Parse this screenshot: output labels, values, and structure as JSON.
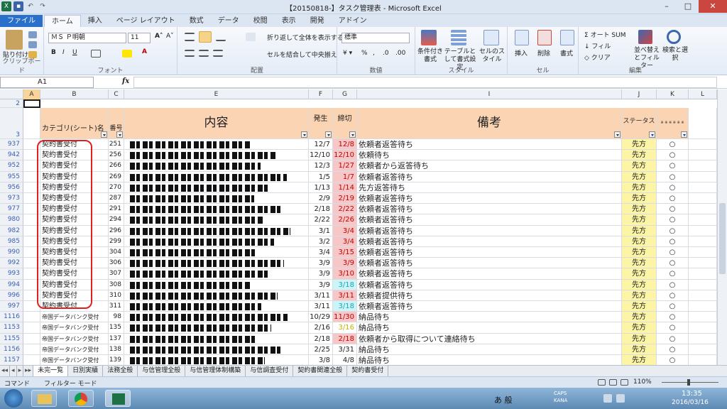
{
  "window": {
    "title": "【20150818-】タスク管理表 - Microsoft Excel"
  },
  "ribbon_tabs": [
    "ファイル",
    "ホーム",
    "挿入",
    "ページ レイアウト",
    "数式",
    "データ",
    "校閲",
    "表示",
    "開発",
    "アドイン"
  ],
  "ribbon": {
    "clipboard": {
      "paste": "貼り付け",
      "group": "クリップボード"
    },
    "font": {
      "name": "ＭＳ Ｐ明朝",
      "size": "11",
      "group": "フォント"
    },
    "alignment": {
      "wrap": "折り返して全体を表示する",
      "merge": "セルを結合して中央揃え",
      "group": "配置"
    },
    "number": {
      "format": "標準",
      "group": "数値"
    },
    "styles": {
      "cond": "条件付き書式",
      "table": "テーブルとして書式設定",
      "cell": "セルのスタイル",
      "group": "スタイル"
    },
    "cells": {
      "insert": "挿入",
      "delete": "削除",
      "format": "書式",
      "group": "セル"
    },
    "editing": {
      "autosum": "オート SUM",
      "fill": "フィル",
      "clear": "クリア",
      "sort": "並べ替えとフィルター",
      "find": "検索と選択",
      "group": "編集"
    }
  },
  "formula_bar": {
    "namebox": "A1",
    "fx": "fx"
  },
  "columns": [
    "A",
    "B",
    "C",
    "E",
    "F",
    "G",
    "I",
    "J",
    "K",
    "L"
  ],
  "header_row": {
    "row_num_2": "2",
    "row_num": "3",
    "category": "カテゴリ(シート)名",
    "no": "番号",
    "content": "内容",
    "issued": "発生",
    "due": "締切",
    "notes": "備考",
    "status": "ステータス",
    "extra": "※ ※ ※ ※ ※ ※"
  },
  "rows": [
    {
      "r": "937",
      "cat": "契約書受付",
      "no": "251",
      "issued": "12/7",
      "due": "12/8",
      "dueFmt": "red",
      "note": "依頼者返答待ち",
      "status": "先方"
    },
    {
      "r": "942",
      "cat": "契約書受付",
      "no": "256",
      "issued": "12/10",
      "due": "12/10",
      "dueFmt": "red",
      "note": "依頼待ち",
      "status": "先方"
    },
    {
      "r": "952",
      "cat": "契約書受付",
      "no": "266",
      "issued": "12/3",
      "due": "1/27",
      "dueFmt": "red",
      "note": "依頼者から返答待ち",
      "status": "先方"
    },
    {
      "r": "955",
      "cat": "契約書受付",
      "no": "269",
      "issued": "1/5",
      "due": "1/7",
      "dueFmt": "red",
      "note": "依頼者返答待ち",
      "status": "先方"
    },
    {
      "r": "956",
      "cat": "契約書受付",
      "no": "270",
      "issued": "1/13",
      "due": "1/14",
      "dueFmt": "red",
      "note": "先方返答待ち",
      "status": "先方"
    },
    {
      "r": "973",
      "cat": "契約書受付",
      "no": "287",
      "issued": "2/9",
      "due": "2/19",
      "dueFmt": "red",
      "note": "依頼者返答待ち",
      "status": "先方"
    },
    {
      "r": "977",
      "cat": "契約書受付",
      "no": "291",
      "issued": "2/18",
      "due": "2/22",
      "dueFmt": "red",
      "note": "依頼者返答待ち",
      "status": "先方"
    },
    {
      "r": "980",
      "cat": "契約書受付",
      "no": "294",
      "issued": "2/22",
      "due": "2/26",
      "dueFmt": "red",
      "note": "依頼者返答待ち",
      "status": "先方"
    },
    {
      "r": "982",
      "cat": "契約書受付",
      "no": "296",
      "issued": "3/1",
      "due": "3/4",
      "dueFmt": "red",
      "note": "依頼者返答待ち",
      "status": "先方"
    },
    {
      "r": "985",
      "cat": "契約書受付",
      "no": "299",
      "issued": "3/2",
      "due": "3/4",
      "dueFmt": "red",
      "note": "依頼者返答待ち",
      "status": "先方"
    },
    {
      "r": "990",
      "cat": "契約書受付",
      "no": "304",
      "issued": "3/4",
      "due": "3/15",
      "dueFmt": "red",
      "note": "依頼者返答待ち",
      "status": "先方"
    },
    {
      "r": "992",
      "cat": "契約書受付",
      "no": "306",
      "issued": "3/9",
      "due": "3/9",
      "dueFmt": "red",
      "note": "依頼者返答待ち",
      "status": "先方"
    },
    {
      "r": "993",
      "cat": "契約書受付",
      "no": "307",
      "issued": "3/9",
      "due": "3/10",
      "dueFmt": "red",
      "note": "依頼者返答待ち",
      "status": "先方"
    },
    {
      "r": "994",
      "cat": "契約書受付",
      "no": "308",
      "issued": "3/9",
      "due": "3/18",
      "dueFmt": "cyan",
      "note": "依頼者返答待ち",
      "status": "先方"
    },
    {
      "r": "996",
      "cat": "契約書受付",
      "no": "310",
      "issued": "3/11",
      "due": "3/11",
      "dueFmt": "red",
      "note": "依頼者提供待ち",
      "status": "先方"
    },
    {
      "r": "997",
      "cat": "契約書受付",
      "no": "311",
      "issued": "3/11",
      "due": "3/18",
      "dueFmt": "cyan",
      "note": "依頼者返答待ち",
      "status": "先方"
    },
    {
      "r": "1116",
      "cat": "帝国データバンク受付",
      "no": "98",
      "issued": "10/29",
      "due": "11/30",
      "dueFmt": "red",
      "note": "納品待ち",
      "status": "先方"
    },
    {
      "r": "1153",
      "cat": "帝国データバンク受付",
      "no": "135",
      "issued": "2/16",
      "due": "3/16",
      "dueFmt": "yellow",
      "note": "納品待ち",
      "status": "先方"
    },
    {
      "r": "1155",
      "cat": "帝国データバンク受付",
      "no": "137",
      "issued": "2/18",
      "due": "2/18",
      "dueFmt": "red",
      "note": "依頼者から取得について連絡待ち",
      "status": "先方"
    },
    {
      "r": "1156",
      "cat": "帝国データバンク受付",
      "no": "138",
      "issued": "2/25",
      "due": "3/31",
      "dueFmt": "none",
      "note": "納品待ち",
      "status": "先方"
    },
    {
      "r": "1157",
      "cat": "帝国データバンク受付",
      "no": "139",
      "issued": "3/8",
      "due": "4/8",
      "dueFmt": "none",
      "note": "納品待ち",
      "status": "先方"
    }
  ],
  "marks": {
    "circle": "○"
  },
  "sheet_tabs": [
    "未完一覧",
    "日別実績",
    "法務全般",
    "与信管理全般",
    "与信管理体制構築",
    "与信調査受付",
    "契約書関連全般",
    "契約書受付"
  ],
  "statusbar": {
    "mode": "コマンド",
    "filter": "フィルター モード",
    "zoom": "110%"
  },
  "taskbar": {
    "ime": "あ 般",
    "caps": "CAPS",
    "kana": "KANA",
    "time": "13:35",
    "date": "2016/03/16"
  },
  "colors": {
    "header": "#fbd4b4",
    "due_red": "#f7c6c6",
    "due_cyan": "#cdf4f7",
    "status": "#fdf5a6",
    "highlight": "#e02020"
  }
}
